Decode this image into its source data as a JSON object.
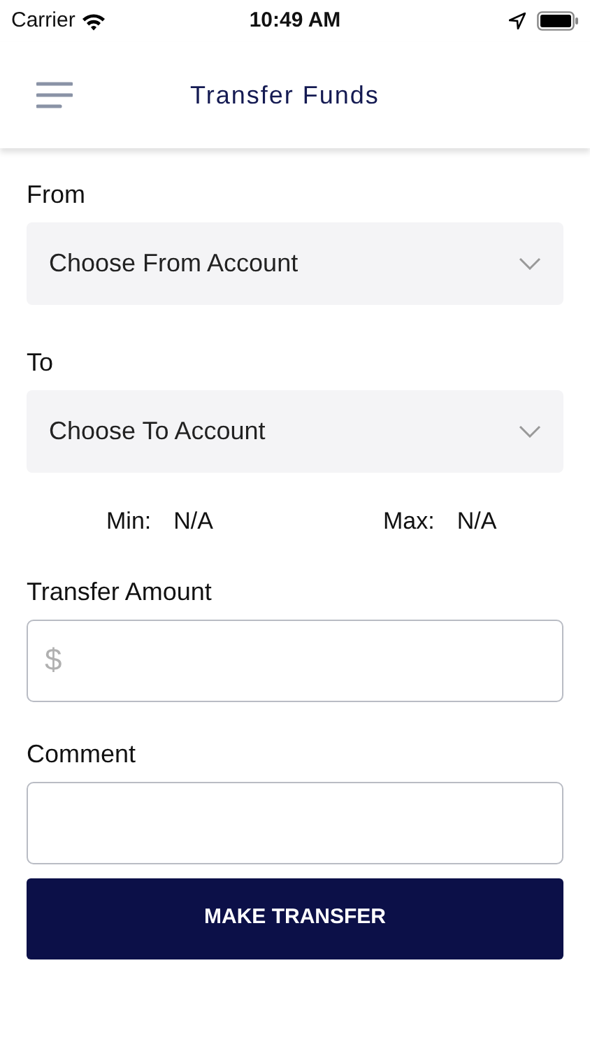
{
  "status_bar": {
    "carrier": "Carrier",
    "time": "10:49 AM"
  },
  "header": {
    "title": "Transfer Funds"
  },
  "selects": [
    {
      "label": "From",
      "value": "Choose From Account"
    },
    {
      "label": "To",
      "value": "Choose To Account"
    }
  ],
  "limits": [
    {
      "label": "Min:",
      "value": "N/A"
    },
    {
      "label": "Max:",
      "value": "N/A"
    }
  ],
  "fields": [
    {
      "label": "Transfer Amount",
      "placeholder": "$"
    },
    {
      "label": "Comment"
    }
  ],
  "submit_button": "MAKE TRANSFER"
}
